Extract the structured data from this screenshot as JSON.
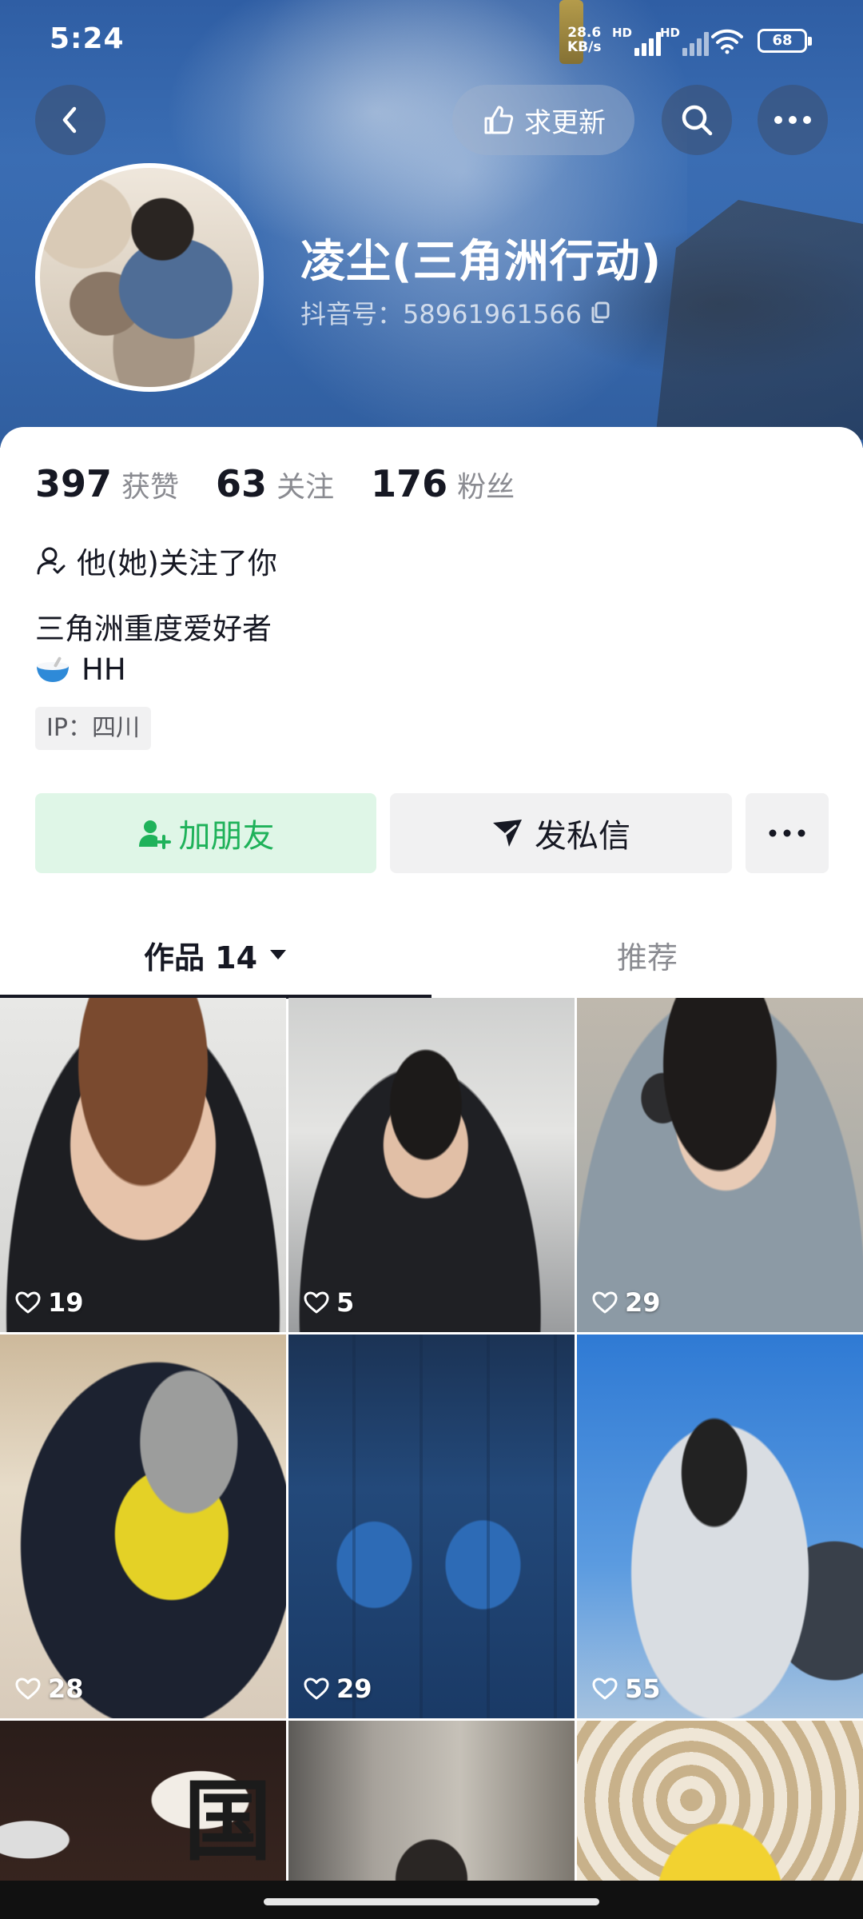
{
  "status_bar": {
    "time": "5:24",
    "net_speed_value": "28.6",
    "net_speed_unit": "KB/s",
    "hd1": "HD",
    "hd2": "HD",
    "battery": "68"
  },
  "header": {
    "update_button_label": "求更新",
    "nickname": "凌尘(三角洲行动)",
    "douyin_id": "抖音号：58961961566"
  },
  "stats": [
    {
      "value": "397",
      "label": "获赞"
    },
    {
      "value": "63",
      "label": "关注"
    },
    {
      "value": "176",
      "label": "粉丝"
    }
  ],
  "profile": {
    "follow_status": "他(她)关注了你",
    "bio_line1": "三角洲重度爱好者",
    "bio_line2": "HH",
    "ip_tag": "IP：四川"
  },
  "actions": {
    "add_friend": "加朋友",
    "message": "发私信"
  },
  "tabs": {
    "works": "作品 14",
    "recommend": "推荐"
  },
  "videos": [
    {
      "likes": "19"
    },
    {
      "likes": "5"
    },
    {
      "likes": "29"
    },
    {
      "likes": "28"
    },
    {
      "likes": "29"
    },
    {
      "likes": "55"
    }
  ],
  "video_glyph": "国",
  "colors": {
    "accent_green": "#1fb25a",
    "add_friend_bg": "#dff6e7",
    "cover_blue": "#3768ad",
    "text_primary": "#161823",
    "text_secondary": "#8a8b91"
  },
  "icons": [
    "back-icon",
    "thumb-up-icon",
    "search-icon",
    "more-icon",
    "copy-icon",
    "follow-user-icon",
    "bowl-emoji-icon",
    "add-user-icon",
    "send-icon",
    "dropdown-triangle-icon",
    "heart-icon"
  ]
}
